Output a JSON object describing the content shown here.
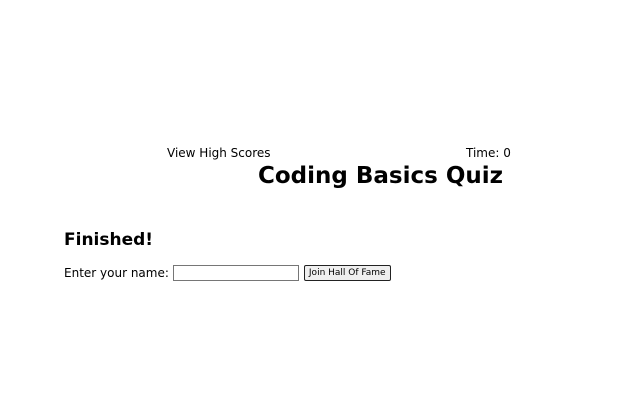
{
  "header": {
    "view_high_scores": "View High Scores",
    "timer_label": "Time: 0"
  },
  "quiz": {
    "title": "Coding Basics Quiz"
  },
  "result": {
    "heading": "Finished!",
    "name_label": "Enter your name:",
    "name_value": "",
    "submit_label": "Join Hall Of Fame"
  }
}
